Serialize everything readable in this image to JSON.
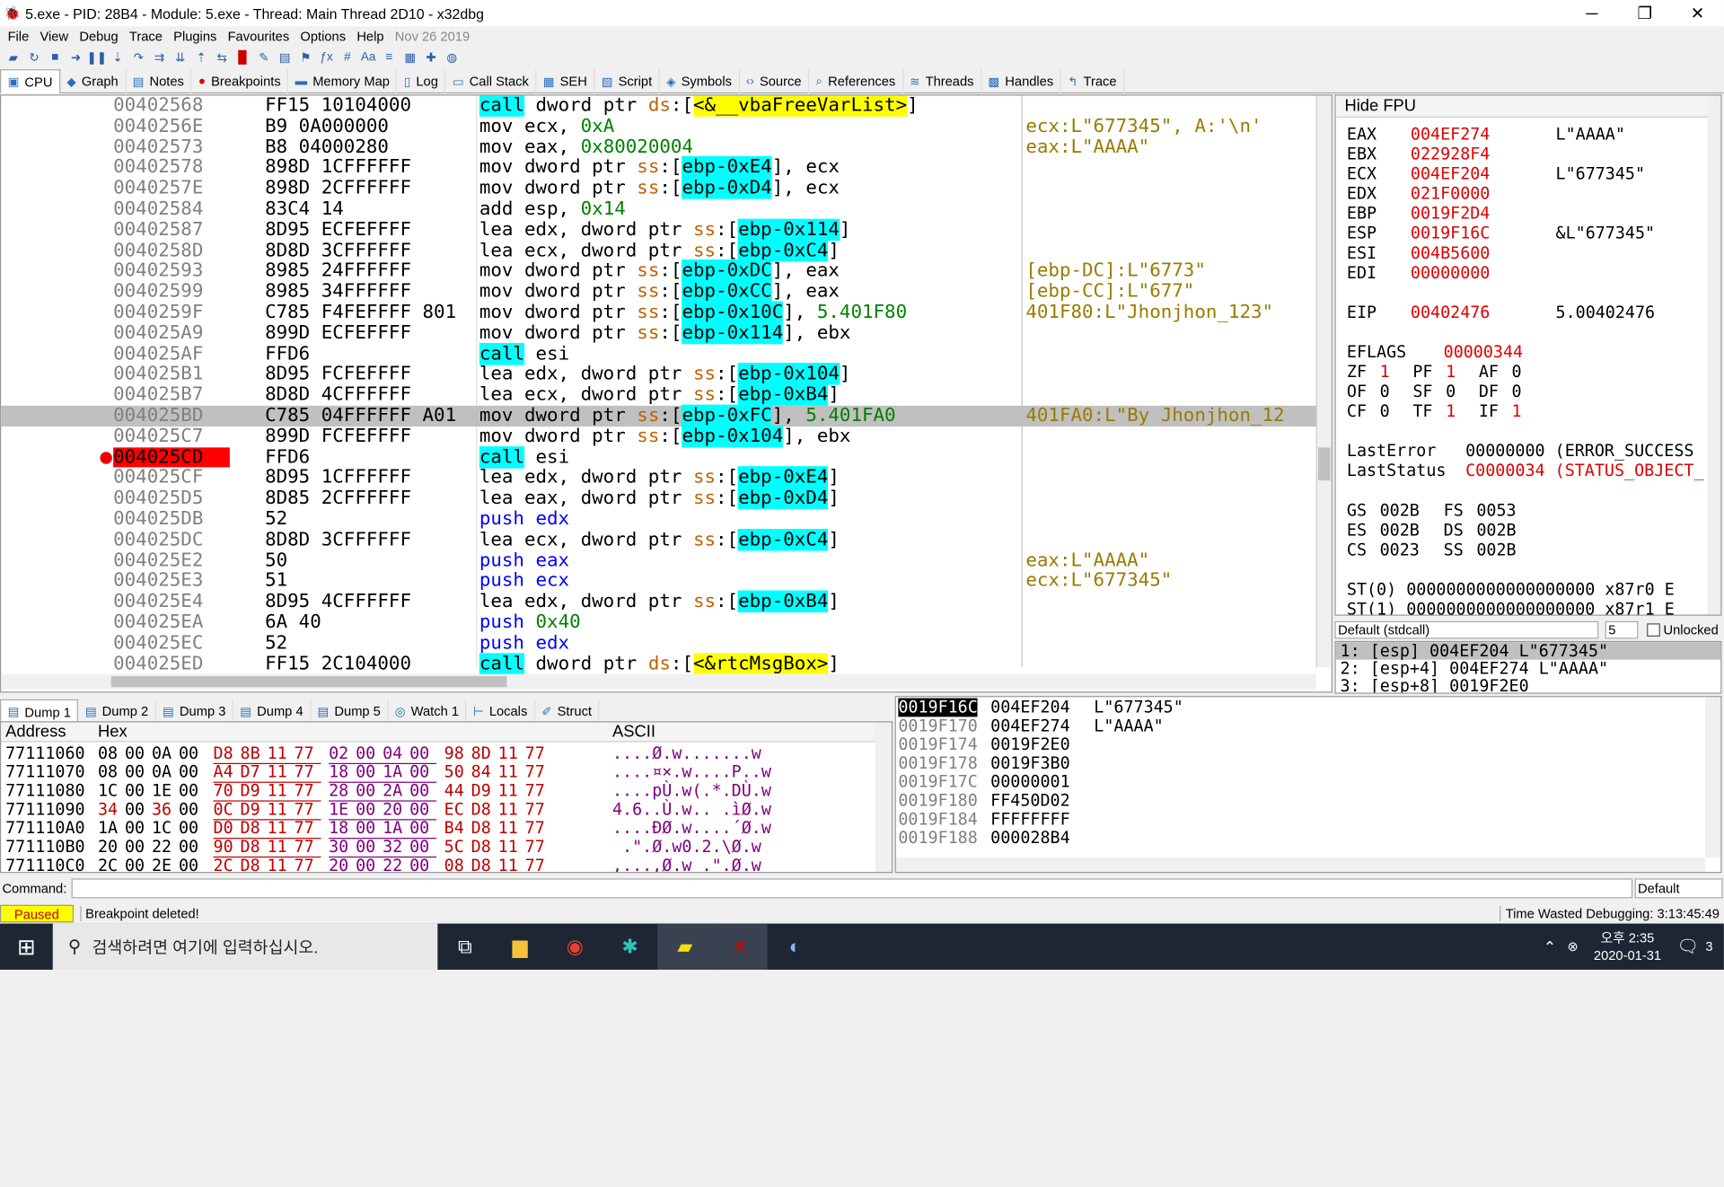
{
  "window": {
    "title": "5.exe - PID: 28B4 - Module: 5.exe - Thread: Main Thread 2D10 - x32dbg",
    "minimize": "─",
    "maximize": "❐",
    "close": "✕"
  },
  "menu": [
    "File",
    "View",
    "Debug",
    "Trace",
    "Plugins",
    "Favourites",
    "Options",
    "Help"
  ],
  "menu_date": "Nov 26 2019",
  "tabs": [
    {
      "label": "CPU",
      "icon": "cpu-icon"
    },
    {
      "label": "Graph",
      "icon": "graph-icon"
    },
    {
      "label": "Notes",
      "icon": "notes-icon"
    },
    {
      "label": "Breakpoints",
      "icon": "breakpoint-icon"
    },
    {
      "label": "Memory Map",
      "icon": "memory-map-icon"
    },
    {
      "label": "Log",
      "icon": "log-icon"
    },
    {
      "label": "Call Stack",
      "icon": "call-stack-icon"
    },
    {
      "label": "SEH",
      "icon": "seh-icon"
    },
    {
      "label": "Script",
      "icon": "script-icon"
    },
    {
      "label": "Symbols",
      "icon": "symbols-icon"
    },
    {
      "label": "Source",
      "icon": "source-icon"
    },
    {
      "label": "References",
      "icon": "references-icon"
    },
    {
      "label": "Threads",
      "icon": "threads-icon"
    },
    {
      "label": "Handles",
      "icon": "handles-icon"
    },
    {
      "label": "Trace",
      "icon": "trace-icon"
    }
  ],
  "disasm": [
    {
      "addr": "00402568",
      "bytes": "FF15 10104000",
      "ins": [
        [
          "kc",
          "call"
        ],
        [
          "kn",
          " dword ptr "
        ],
        [
          "ks",
          "ds"
        ],
        [
          "kn",
          ":["
        ],
        [
          "kb",
          "<&__vbaFreeVarList>"
        ],
        [
          "kn",
          "]"
        ]
      ],
      "cmt": ""
    },
    {
      "addr": "0040256E",
      "bytes": "B9 0A000000",
      "ins": [
        [
          "kn",
          "mov ecx, "
        ],
        [
          "kr",
          "0xA"
        ]
      ],
      "cmt": "ecx:L\"677345\", A:'\\n'"
    },
    {
      "addr": "00402573",
      "bytes": "B8 04000280",
      "ins": [
        [
          "kn",
          "mov eax, "
        ],
        [
          "kr",
          "0x80020004"
        ]
      ],
      "cmt": "eax:L\"AAAA\""
    },
    {
      "addr": "00402578",
      "bytes": "898D 1CFFFFFF",
      "ins": [
        [
          "kn",
          "mov dword ptr "
        ],
        [
          "ks",
          "ss"
        ],
        [
          "kn",
          ":["
        ],
        [
          "kc",
          "ebp-0xE4"
        ],
        [
          "kn",
          "], ecx"
        ]
      ],
      "cmt": ""
    },
    {
      "addr": "0040257E",
      "bytes": "898D 2CFFFFFF",
      "ins": [
        [
          "kn",
          "mov dword ptr "
        ],
        [
          "ks",
          "ss"
        ],
        [
          "kn",
          ":["
        ],
        [
          "kc",
          "ebp-0xD4"
        ],
        [
          "kn",
          "], ecx"
        ]
      ],
      "cmt": ""
    },
    {
      "addr": "00402584",
      "bytes": "83C4 14",
      "ins": [
        [
          "kn",
          "add esp, "
        ],
        [
          "kr",
          "0x14"
        ]
      ],
      "cmt": ""
    },
    {
      "addr": "00402587",
      "bytes": "8D95 ECFEFFFF",
      "ins": [
        [
          "kn",
          "lea edx, dword ptr "
        ],
        [
          "ks",
          "ss"
        ],
        [
          "kn",
          ":["
        ],
        [
          "kc",
          "ebp-0x114"
        ],
        [
          "kn",
          "]"
        ]
      ],
      "cmt": ""
    },
    {
      "addr": "0040258D",
      "bytes": "8D8D 3CFFFFFF",
      "ins": [
        [
          "kn",
          "lea ecx, dword ptr "
        ],
        [
          "ks",
          "ss"
        ],
        [
          "kn",
          ":["
        ],
        [
          "kc",
          "ebp-0xC4"
        ],
        [
          "kn",
          "]"
        ]
      ],
      "cmt": ""
    },
    {
      "addr": "00402593",
      "bytes": "8985 24FFFFFF",
      "ins": [
        [
          "kn",
          "mov dword ptr "
        ],
        [
          "ks",
          "ss"
        ],
        [
          "kn",
          ":["
        ],
        [
          "kc",
          "ebp-0xDC"
        ],
        [
          "kn",
          "], eax"
        ]
      ],
      "cmt": "[ebp-DC]:L\"6773\""
    },
    {
      "addr": "00402599",
      "bytes": "8985 34FFFFFF",
      "ins": [
        [
          "kn",
          "mov dword ptr "
        ],
        [
          "ks",
          "ss"
        ],
        [
          "kn",
          ":["
        ],
        [
          "kc",
          "ebp-0xCC"
        ],
        [
          "kn",
          "], eax"
        ]
      ],
      "cmt": "[ebp-CC]:L\"677\""
    },
    {
      "addr": "0040259F",
      "bytes": "C785 F4FEFFFF 801",
      "ins": [
        [
          "kn",
          "mov dword ptr "
        ],
        [
          "ks",
          "ss"
        ],
        [
          "kn",
          ":["
        ],
        [
          "kc",
          "ebp-0x10C"
        ],
        [
          "kn",
          "], "
        ],
        [
          "kr",
          "5.401F80"
        ]
      ],
      "cmt": "401F80:L\"Jhonjhon_123\""
    },
    {
      "addr": "004025A9",
      "bytes": "899D ECFEFFFF",
      "ins": [
        [
          "kn",
          "mov dword ptr "
        ],
        [
          "ks",
          "ss"
        ],
        [
          "kn",
          ":["
        ],
        [
          "kc",
          "ebp-0x114"
        ],
        [
          "kn",
          "], ebx"
        ]
      ],
      "cmt": ""
    },
    {
      "addr": "004025AF",
      "bytes": "FFD6",
      "ins": [
        [
          "kc",
          "call"
        ],
        [
          "kn",
          " esi"
        ]
      ],
      "cmt": ""
    },
    {
      "addr": "004025B1",
      "bytes": "8D95 FCFEFFFF",
      "ins": [
        [
          "kn",
          "lea edx, dword ptr "
        ],
        [
          "ks",
          "ss"
        ],
        [
          "kn",
          ":["
        ],
        [
          "kc",
          "ebp-0x104"
        ],
        [
          "kn",
          "]"
        ]
      ],
      "cmt": ""
    },
    {
      "addr": "004025B7",
      "bytes": "8D8D 4CFFFFFF",
      "ins": [
        [
          "kn",
          "lea ecx, dword ptr "
        ],
        [
          "ks",
          "ss"
        ],
        [
          "kn",
          ":["
        ],
        [
          "kc",
          "ebp-0xB4"
        ],
        [
          "kn",
          "]"
        ]
      ],
      "cmt": ""
    },
    {
      "addr": "004025BD",
      "bytes": "C785 04FFFFFF A01",
      "ins": [
        [
          "kn",
          "mov dword ptr "
        ],
        [
          "ks",
          "ss"
        ],
        [
          "kn",
          ":["
        ],
        [
          "kc",
          "ebp-0xFC"
        ],
        [
          "kn",
          "], "
        ],
        [
          "kr",
          "5.401FA0"
        ]
      ],
      "cmt": "401FA0:L\"By Jhonjhon_12",
      "sel": true
    },
    {
      "addr": "004025C7",
      "bytes": "899D FCFEFFFF",
      "ins": [
        [
          "kn",
          "mov dword ptr "
        ],
        [
          "ks",
          "ss"
        ],
        [
          "kn",
          ":["
        ],
        [
          "kc",
          "ebp-0x104"
        ],
        [
          "kn",
          "], ebx"
        ]
      ],
      "cmt": ""
    },
    {
      "addr": "004025CD",
      "bytes": "FFD6",
      "ins": [
        [
          "kc",
          "call"
        ],
        [
          "kn",
          " esi"
        ]
      ],
      "cmt": "",
      "bp": true
    },
    {
      "addr": "004025CF",
      "bytes": "8D95 1CFFFFFF",
      "ins": [
        [
          "kn",
          "lea edx, dword ptr "
        ],
        [
          "ks",
          "ss"
        ],
        [
          "kn",
          ":["
        ],
        [
          "kc",
          "ebp-0xE4"
        ],
        [
          "kn",
          "]"
        ]
      ],
      "cmt": ""
    },
    {
      "addr": "004025D5",
      "bytes": "8D85 2CFFFFFF",
      "ins": [
        [
          "kn",
          "lea eax, dword ptr "
        ],
        [
          "ks",
          "ss"
        ],
        [
          "kn",
          ":["
        ],
        [
          "kc",
          "ebp-0xD4"
        ],
        [
          "kn",
          "]"
        ]
      ],
      "cmt": ""
    },
    {
      "addr": "004025DB",
      "bytes": "52",
      "ins": [
        [
          "kg",
          "push edx"
        ]
      ],
      "cmt": ""
    },
    {
      "addr": "004025DC",
      "bytes": "8D8D 3CFFFFFF",
      "ins": [
        [
          "kn",
          "lea ecx, dword ptr "
        ],
        [
          "ks",
          "ss"
        ],
        [
          "kn",
          ":["
        ],
        [
          "kc",
          "ebp-0xC4"
        ],
        [
          "kn",
          "]"
        ]
      ],
      "cmt": ""
    },
    {
      "addr": "004025E2",
      "bytes": "50",
      "ins": [
        [
          "kg",
          "push eax"
        ]
      ],
      "cmt": "eax:L\"AAAA\""
    },
    {
      "addr": "004025E3",
      "bytes": "51",
      "ins": [
        [
          "kg",
          "push ecx"
        ]
      ],
      "cmt": "ecx:L\"677345\""
    },
    {
      "addr": "004025E4",
      "bytes": "8D95 4CFFFFFF",
      "ins": [
        [
          "kn",
          "lea edx, dword ptr "
        ],
        [
          "ks",
          "ss"
        ],
        [
          "kn",
          ":["
        ],
        [
          "kc",
          "ebp-0xB4"
        ],
        [
          "kn",
          "]"
        ]
      ],
      "cmt": ""
    },
    {
      "addr": "004025EA",
      "bytes": "6A 40",
      "ins": [
        [
          "kg",
          "push "
        ],
        [
          "kr",
          "0x40"
        ]
      ],
      "cmt": ""
    },
    {
      "addr": "004025EC",
      "bytes": "52",
      "ins": [
        [
          "kg",
          "push edx"
        ]
      ],
      "cmt": ""
    },
    {
      "addr": "004025ED",
      "bytes": "FF15 2C104000",
      "ins": [
        [
          "kc",
          "call"
        ],
        [
          "kn",
          " dword ptr "
        ],
        [
          "ks",
          "ds"
        ],
        [
          "kn",
          ":["
        ],
        [
          "kb",
          "<&rtcMsgBox>"
        ],
        [
          "kn",
          "]"
        ]
      ],
      "cmt": ""
    }
  ],
  "registers": {
    "header": "Hide FPU",
    "rows": [
      {
        "name": "EAX",
        "value": "004EF274",
        "extra": "L\"AAAA\""
      },
      {
        "name": "EBX",
        "value": "022928F4",
        "extra": ""
      },
      {
        "name": "ECX",
        "value": "004EF204",
        "extra": "L\"677345\""
      },
      {
        "name": "EDX",
        "value": "021F0000",
        "extra": ""
      },
      {
        "name": "EBP",
        "value": "0019F2D4",
        "extra": ""
      },
      {
        "name": "ESP",
        "value": "0019F16C",
        "extra": "&L\"677345\""
      },
      {
        "name": "ESI",
        "value": "004B5600",
        "extra": ""
      },
      {
        "name": "EDI",
        "value": "00000000",
        "extra": ""
      },
      {
        "name": "EIP",
        "value": "00402476",
        "extra": "5.00402476"
      }
    ],
    "eflags_label": "EFLAGS",
    "eflags": "00000344",
    "flags_rows": [
      [
        [
          "ZF",
          "1"
        ],
        [
          "PF",
          "1"
        ],
        [
          "AF",
          "0"
        ]
      ],
      [
        [
          "OF",
          "0"
        ],
        [
          "SF",
          "0"
        ],
        [
          "DF",
          "0"
        ]
      ],
      [
        [
          "CF",
          "0"
        ],
        [
          "TF",
          "1"
        ],
        [
          "IF",
          "1"
        ]
      ]
    ],
    "lasterror_label": "LastError",
    "lasterror": "00000000 (ERROR_SUCCESS",
    "laststatus_label": "LastStatus",
    "laststatus": "C0000034 (STATUS_OBJECT_",
    "segs": [
      [
        [
          "GS",
          "002B"
        ],
        [
          "FS",
          "0053"
        ]
      ],
      [
        [
          "ES",
          "002B"
        ],
        [
          "DS",
          "002B"
        ]
      ],
      [
        [
          "CS",
          "0023"
        ],
        [
          "SS",
          "002B"
        ]
      ]
    ],
    "st0": "ST(0) 0000000000000000000 x87r0 E",
    "st1": "ST(1) 0000000000000000000 x87r1 E"
  },
  "callconv": {
    "selected": "Default (stdcall)",
    "count": "5",
    "unlocked": "Unlocked"
  },
  "args": [
    "1: [esp] 004EF204 L\"677345\"",
    "2: [esp+4] 004EF274 L\"AAAA\"",
    "3: [esp+8] 0019F2E0"
  ],
  "dump_tabs": [
    {
      "label": "Dump 1",
      "icon": "dump-icon"
    },
    {
      "label": "Dump 2",
      "icon": "dump-icon"
    },
    {
      "label": "Dump 3",
      "icon": "dump-icon"
    },
    {
      "label": "Dump 4",
      "icon": "dump-icon"
    },
    {
      "label": "Dump 5",
      "icon": "dump-icon"
    },
    {
      "label": "Watch 1",
      "icon": "watch-icon"
    },
    {
      "label": "Locals",
      "icon": "locals-icon"
    },
    {
      "label": "Struct",
      "icon": "struct-icon"
    }
  ],
  "dump": {
    "col_addr": "Address",
    "col_hex": "Hex",
    "col_ascii": "ASCII",
    "rows": [
      {
        "addr": "77111060",
        "hex": [
          "08",
          "00",
          "0A",
          "00",
          "D8",
          "8B",
          "11",
          "77",
          "02",
          "00",
          "04",
          "00",
          "98",
          "8D",
          "11",
          "77"
        ],
        "ascii": "....Ø.w.......w"
      },
      {
        "addr": "77111070",
        "hex": [
          "08",
          "00",
          "0A",
          "00",
          "A4",
          "D7",
          "11",
          "77",
          "18",
          "00",
          "1A",
          "00",
          "50",
          "84",
          "11",
          "77"
        ],
        "ascii": "....¤×.w....P..w"
      },
      {
        "addr": "77111080",
        "hex": [
          "1C",
          "00",
          "1E",
          "00",
          "70",
          "D9",
          "11",
          "77",
          "28",
          "00",
          "2A",
          "00",
          "44",
          "D9",
          "11",
          "77"
        ],
        "ascii": "....pÙ.w(.*.DÙ.w"
      },
      {
        "addr": "77111090",
        "hex": [
          "34",
          "00",
          "36",
          "00",
          "0C",
          "D9",
          "11",
          "77",
          "1E",
          "00",
          "20",
          "00",
          "EC",
          "D8",
          "11",
          "77"
        ],
        "ascii": "4.6..Ù.w.. .ìØ.w"
      },
      {
        "addr": "771110A0",
        "hex": [
          "1A",
          "00",
          "1C",
          "00",
          "D0",
          "D8",
          "11",
          "77",
          "18",
          "00",
          "1A",
          "00",
          "B4",
          "D8",
          "11",
          "77"
        ],
        "ascii": "....ÐØ.w....´Ø.w"
      },
      {
        "addr": "771110B0",
        "hex": [
          "20",
          "00",
          "22",
          "00",
          "90",
          "D8",
          "11",
          "77",
          "30",
          "00",
          "32",
          "00",
          "5C",
          "D8",
          "11",
          "77"
        ],
        "ascii": " .\".Ø.w0.2.\\Ø.w"
      },
      {
        "addr": "771110C0",
        "hex": [
          "2C",
          "00",
          "2E",
          "00",
          "2C",
          "D8",
          "11",
          "77",
          "20",
          "00",
          "22",
          "00",
          "08",
          "D8",
          "11",
          "77"
        ],
        "ascii": ",...,Ø.w .\".Ø.w"
      }
    ]
  },
  "stack": [
    {
      "addr": "0019F16C",
      "val": "004EF204",
      "cmt": "L\"677345\"",
      "top": true
    },
    {
      "addr": "0019F170",
      "val": "004EF274",
      "cmt": "L\"AAAA\""
    },
    {
      "addr": "0019F174",
      "val": "0019F2E0",
      "cmt": ""
    },
    {
      "addr": "0019F178",
      "val": "0019F3B0",
      "cmt": ""
    },
    {
      "addr": "0019F17C",
      "val": "00000001",
      "cmt": ""
    },
    {
      "addr": "0019F180",
      "val": "FF450D02",
      "cmt": ""
    },
    {
      "addr": "0019F184",
      "val": "FFFFFFFF",
      "cmt": ""
    },
    {
      "addr": "0019F188",
      "val": "000028B4",
      "cmt": ""
    }
  ],
  "command": {
    "label": "Command:",
    "mode": "Default"
  },
  "status": {
    "state": "Paused",
    "message": "Breakpoint deleted!",
    "time": "Time Wasted Debugging: 3:13:45:49"
  },
  "taskbar": {
    "search_placeholder": "검색하려면 여기에 입력하십시오.",
    "time": "오후 2:35",
    "date": "2020-01-31",
    "notif": "3"
  }
}
